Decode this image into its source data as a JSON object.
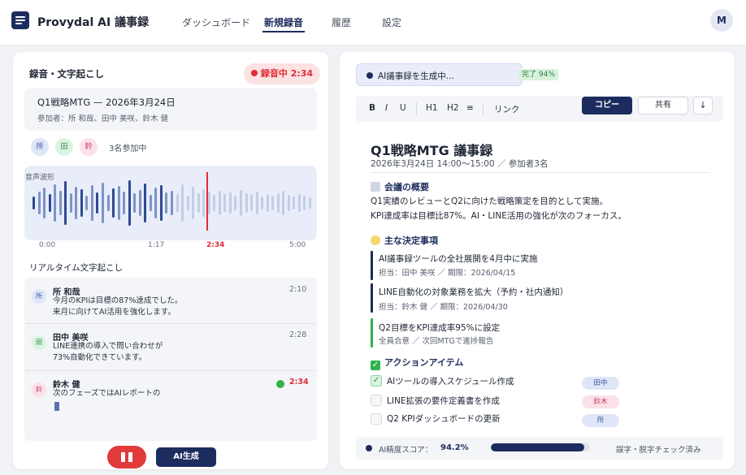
{
  "app": {
    "name": "Provydal AI 議事録",
    "user_initial": "M"
  },
  "nav": [
    {
      "label": "ダッシュボード",
      "active": false
    },
    {
      "label": "新規録音",
      "active": true
    },
    {
      "label": "履歴",
      "active": false
    },
    {
      "label": "設定",
      "active": false
    }
  ],
  "recording": {
    "panel_title": "録音・文字起こし",
    "badge": "録音中 2:34",
    "meeting_title": "Q1戦略MTG — 2026年3月24日",
    "participants_line": "参加者：所 和哉、田中 美咲、鈴木 健",
    "avatars": [
      "所",
      "田",
      "鈴"
    ],
    "participant_count": "3名参加中",
    "waveform_label": "音声波形",
    "progress_fraction": 0.513,
    "times": {
      "start": "0:00",
      "mid": "1:17",
      "current": "2:34",
      "end": "5:00"
    }
  },
  "transcript": {
    "title": "リアルタイム文字起こし",
    "items": [
      {
        "avatar": "所",
        "name": "所 和哉",
        "line1": "今月のKPIは目標の87%達成でした。",
        "line2": "来月に向けてAI活用を強化します。",
        "time": "2:10"
      },
      {
        "avatar": "田",
        "name": "田中 美咲",
        "line1": "LINE連携の導入で問い合わせが",
        "line2": "73%自動化できています。",
        "time": "2:28"
      },
      {
        "avatar": "鈴",
        "name": "鈴木 健",
        "line1": "次のフェーズではAIレポートの",
        "line2": "",
        "time": "2:34"
      }
    ]
  },
  "controls": {
    "ai_generate": "AI生成"
  },
  "minutes": {
    "status": "AI議事録を生成中...",
    "done_badge": "完了 94%",
    "toolbar": {
      "bold": "B",
      "italic": "I",
      "underline": "U",
      "h1": "H1",
      "h2": "H2",
      "list": "≡",
      "link": "リンク",
      "copy": "コピー",
      "share": "共有",
      "download": "↓"
    },
    "title": "Q1戦略MTG 議事録",
    "subtitle": "2026年3月24日 14:00〜15:00 ／ 参加者3名",
    "overview_heading": "会議の概要",
    "overview_line1": "Q1実績のレビューとQ2に向けた戦略策定を目的として実施。",
    "overview_line2": "KPI達成率は目標比87%。AI・LINE活用の強化が次のフォーカス。",
    "decisions_heading": "主な決定事項",
    "decisions": [
      {
        "text": "AI議事録ツールの全社展開を4月中に実施",
        "meta": "担当：田中 美咲 ／ 期限：2026/04/15",
        "color": "#1d2c5e"
      },
      {
        "text": "LINE自動化の対象業務を拡大（予約・社内通知）",
        "meta": "担当：鈴木 健 ／ 期限：2026/04/30",
        "color": "#1d2c5e"
      },
      {
        "text": "Q2目標をKPI達成率95%に設定",
        "meta": "全員合意 ／ 次回MTGで進捗報告",
        "color": "#2fb34f"
      }
    ],
    "actions_heading": "アクションアイテム",
    "actions": [
      {
        "text": "AIツールの導入スケジュール作成",
        "owner": "田中",
        "done": true
      },
      {
        "text": "LINE拡張の要件定義書を作成",
        "owner": "鈴木",
        "done": false
      },
      {
        "text": "Q2 KPIダッシュボードの更新",
        "owner": "所",
        "done": false
      }
    ],
    "score_label": "AI精度スコア：",
    "score_value": "94.2%",
    "score_fraction": 0.942,
    "score_note": "誤字・脱字チェック済み"
  },
  "colors": {
    "brand": "#1d2c5e",
    "recording": "#e02b35",
    "success": "#2fb34f"
  }
}
